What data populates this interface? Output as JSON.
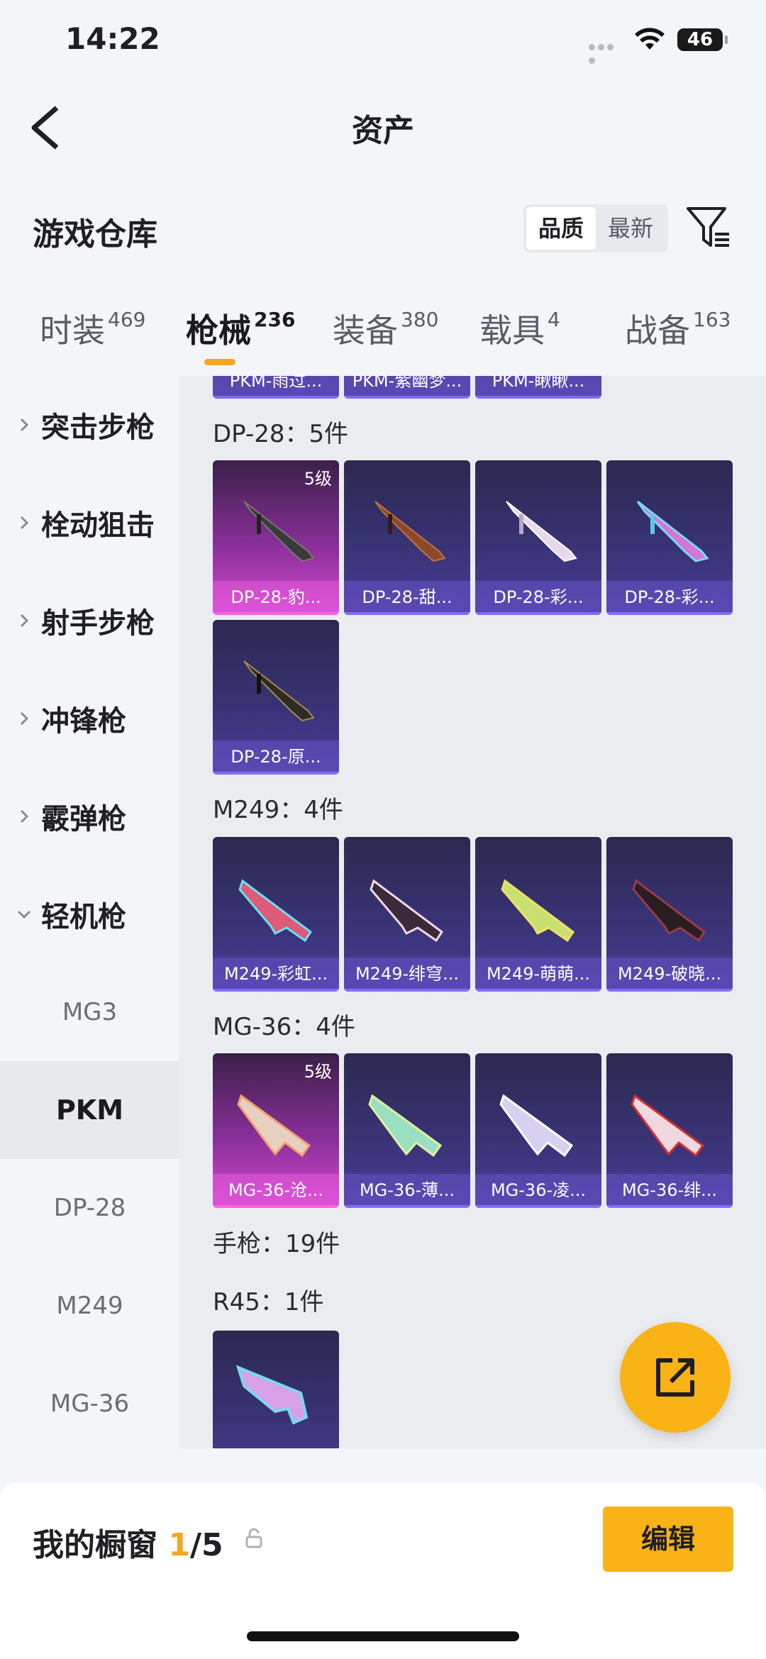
{
  "status": {
    "time": "14:22",
    "battery": "46"
  },
  "header": {
    "title": "资产"
  },
  "section": {
    "title": "游戏仓库"
  },
  "sort": {
    "options": [
      "品质",
      "最新"
    ],
    "selected": "品质"
  },
  "tabs": [
    {
      "label": "时装",
      "count": "469"
    },
    {
      "label": "枪械",
      "count": "236"
    },
    {
      "label": "装备",
      "count": "380"
    },
    {
      "label": "载具",
      "count": "4"
    },
    {
      "label": "战备",
      "count": "163"
    }
  ],
  "sidebar": {
    "categories": [
      "突击步枪",
      "栓动狙击",
      "射手步枪",
      "冲锋枪",
      "霰弹枪",
      "轻机枪"
    ],
    "subitems": [
      "MG3",
      "PKM",
      "DP-28",
      "M249",
      "MG-36"
    ],
    "active_sub": "PKM"
  },
  "content": {
    "partial_row": [
      "PKM-雨过...",
      "PKM-紫幽梦...",
      "PKM-瞅瞅..."
    ],
    "groups": [
      {
        "title": "DP-28：5件",
        "items": [
          {
            "name": "DP-28-豹...",
            "level": "5级",
            "epic": true
          },
          {
            "name": "DP-28-甜...",
            "level": "",
            "epic": false
          },
          {
            "name": "DP-28-彩...",
            "level": "",
            "epic": false
          },
          {
            "name": "DP-28-彩...",
            "level": "",
            "epic": false
          },
          {
            "name": "DP-28-原...",
            "level": "",
            "epic": false
          }
        ]
      },
      {
        "title": "M249：4件",
        "items": [
          {
            "name": "M249-彩虹...",
            "level": "",
            "epic": false
          },
          {
            "name": "M249-绯穹...",
            "level": "",
            "epic": false
          },
          {
            "name": "M249-萌萌...",
            "level": "",
            "epic": false
          },
          {
            "name": "M249-破晓...",
            "level": "",
            "epic": false
          }
        ]
      },
      {
        "title": "MG-36：4件",
        "items": [
          {
            "name": "MG-36-沧...",
            "level": "5级",
            "epic": true
          },
          {
            "name": "MG-36-薄...",
            "level": "",
            "epic": false
          },
          {
            "name": "MG-36-凌...",
            "level": "",
            "epic": false
          },
          {
            "name": "MG-36-绯...",
            "level": "",
            "epic": false
          }
        ]
      }
    ],
    "pistol_title": "手枪：19件",
    "r45": {
      "title": "R45：1件"
    }
  },
  "showcase": {
    "label": "我的橱窗",
    "current": "1",
    "total": "/5",
    "edit_label": "编辑"
  },
  "colors": {
    "accent": "#f9b317",
    "card": "#3a3478",
    "epic": "#d54ad0"
  }
}
